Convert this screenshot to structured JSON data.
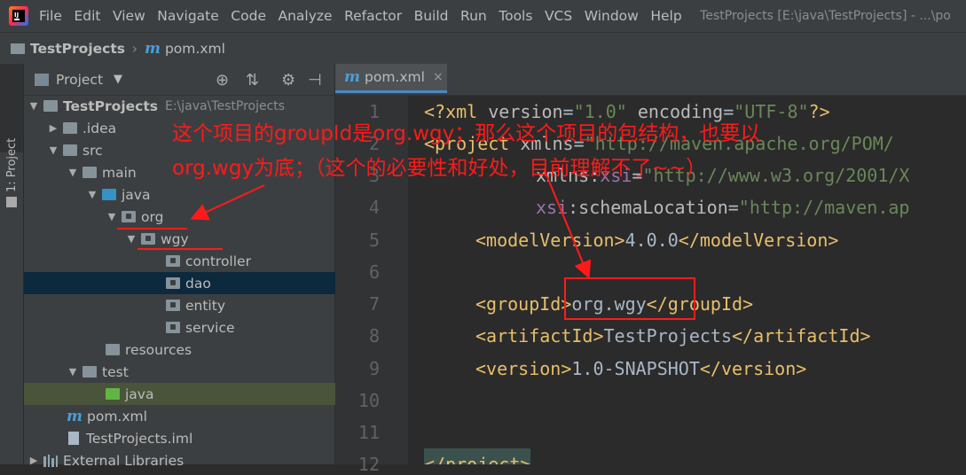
{
  "menubar": {
    "items": [
      "File",
      "Edit",
      "View",
      "Navigate",
      "Code",
      "Analyze",
      "Refactor",
      "Build",
      "Run",
      "Tools",
      "VCS",
      "Window",
      "Help"
    ],
    "window_title": "TestProjects [E:\\java\\TestProjects] - ...\\po"
  },
  "navbar": {
    "project": "TestProjects",
    "file": "pom.xml",
    "file_icon": "m"
  },
  "toolstrip": {
    "project_tab": "1: Project"
  },
  "project_panel": {
    "title": "Project",
    "tree": [
      {
        "label": "TestProjects",
        "path": "E:\\java\\TestProjects"
      },
      {
        "label": ".idea"
      },
      {
        "label": "src"
      },
      {
        "label": "main"
      },
      {
        "label": "java"
      },
      {
        "label": "org"
      },
      {
        "label": "wgy"
      },
      {
        "label": "controller"
      },
      {
        "label": "dao"
      },
      {
        "label": "entity"
      },
      {
        "label": "service"
      },
      {
        "label": "resources"
      },
      {
        "label": "test"
      },
      {
        "label": "java"
      },
      {
        "label": "pom.xml"
      },
      {
        "label": "TestProjects.iml"
      },
      {
        "label": "External Libraries"
      }
    ]
  },
  "editor": {
    "tab_label": "pom.xml",
    "line_numbers": [
      "1",
      "2",
      "3",
      "4",
      "5",
      "6",
      "7",
      "8",
      "9",
      "10",
      "11",
      "12"
    ],
    "code": {
      "l1": [
        "<?xml ",
        "version",
        "=",
        "\"1.0\"",
        " encoding",
        "=",
        "\"UTF-8\"",
        "?>"
      ],
      "l2": [
        "<project ",
        "xmlns",
        "=",
        "\"http://maven.apache.org/POM/"
      ],
      "l3": [
        "xmlns",
        ":",
        "xsi",
        "=",
        "\"http://www.w3.org/2001/X"
      ],
      "l4": [
        "xsi",
        ":",
        "schemaLocation",
        "=",
        "\"http://maven.ap"
      ],
      "l5": [
        "<modelVersion>",
        "4.0.0",
        "</modelVersion>"
      ],
      "l7": [
        "<groupId>",
        "org.wgy",
        "</groupId>"
      ],
      "l8": [
        "<artifactId>",
        "TestProjects",
        "</artifactId>"
      ],
      "l9": [
        "<version>",
        "1.0-SNAPSHOT",
        "</version>"
      ],
      "l12": [
        "</project>"
      ]
    }
  },
  "annotation": {
    "line1": "这个项目的groupId是org.wgy；那么这个项目的包结构，也要以",
    "line2": "org.wgy为底；（这个的必要性和好处，目前理解不了~~）",
    "color": "#ff1a1a"
  },
  "colors": {
    "selection": "#0d293e",
    "highlight": "#49543a",
    "tag": "#e8bf6a",
    "string": "#6a8759",
    "namespace": "#9876aa"
  }
}
